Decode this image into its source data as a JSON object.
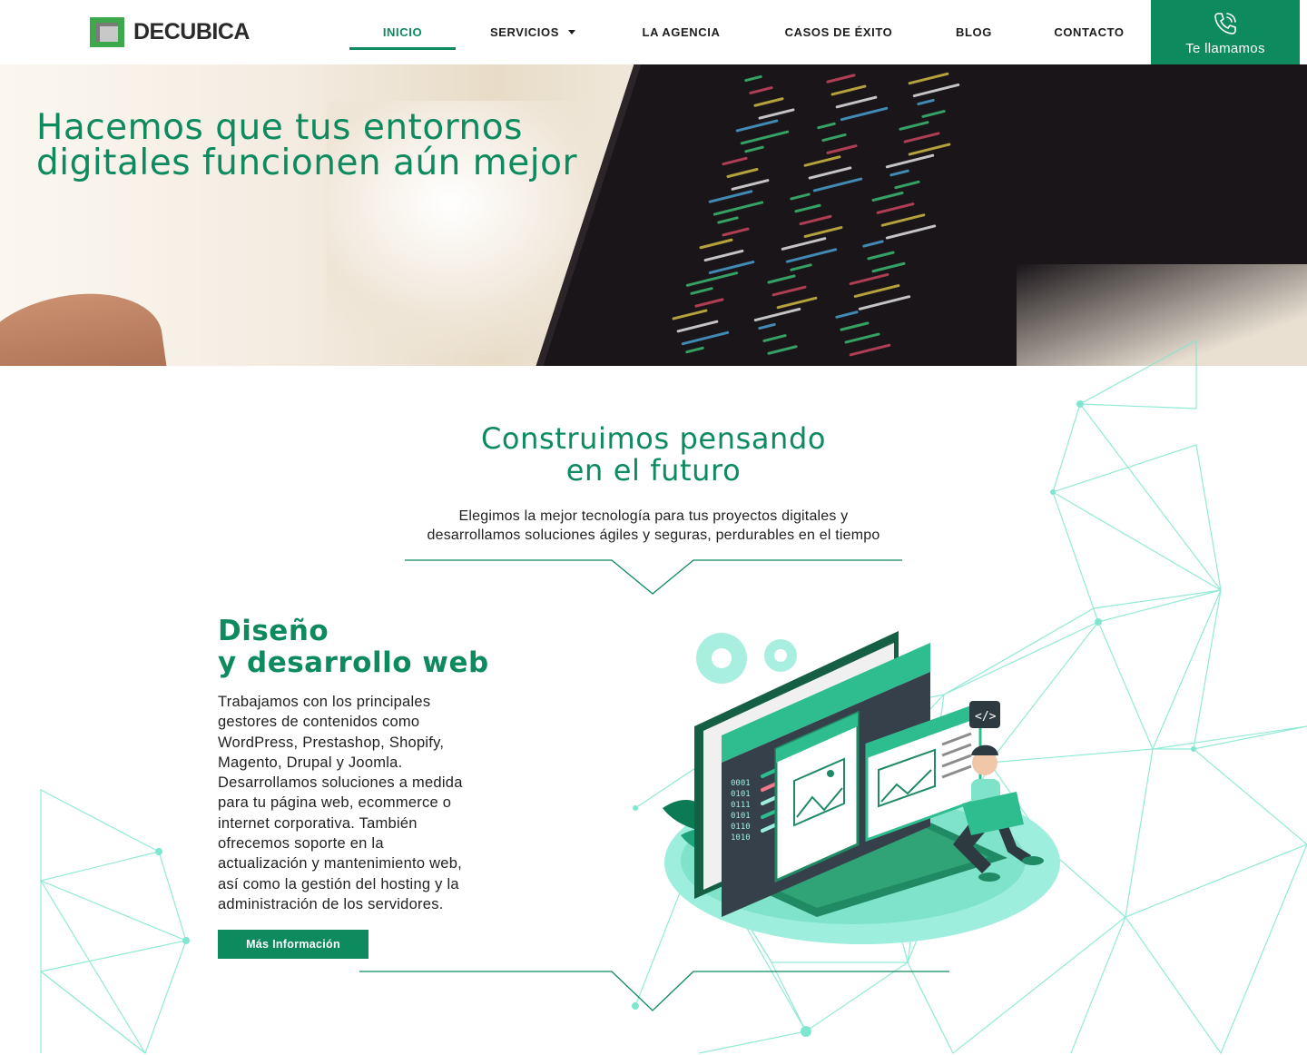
{
  "brand": {
    "logo_text": "DECUBICA"
  },
  "nav": {
    "items": [
      {
        "label": "INICIO",
        "active": true
      },
      {
        "label": "SERVICIOS",
        "has_dropdown": true
      },
      {
        "label": "LA AGENCIA"
      },
      {
        "label": "CASOS DE ÉXITO"
      },
      {
        "label": "BLOG"
      },
      {
        "label": "CONTACTO"
      }
    ],
    "call_button_label": "Te llamamos"
  },
  "hero": {
    "title": "Hacemos que tus entornos digitales funcionen aún mejor"
  },
  "intro": {
    "title_line1": "Construimos pensando",
    "title_line2": "en el futuro",
    "text_line1": "Elegimos la mejor tecnología para tus proyectos digitales y",
    "text_line2": "desarrollamos soluciones ágiles y seguras, perdurables en el tiempo"
  },
  "service": {
    "title_line1": "Diseño",
    "title_line2": "y desarrollo web",
    "description_lines": [
      "Trabajamos con los principales",
      "gestores de contenidos como",
      "WordPress, Prestashop, Shopify,",
      "Magento, Drupal y Joomla.",
      "Desarrollamos soluciones a medida",
      "para tu página web, ecommerce o",
      "internet corporativa.  También",
      "ofrecemos soporte en la",
      "actualización y mantenimiento web,",
      "así como la gestión del hosting y la",
      "administración de los servidores."
    ],
    "button_label": "Más Información"
  },
  "colors": {
    "brand_green": "#0d8a5e",
    "accent_mint": "#5fe0c4",
    "logo_green": "#3ea84c"
  }
}
